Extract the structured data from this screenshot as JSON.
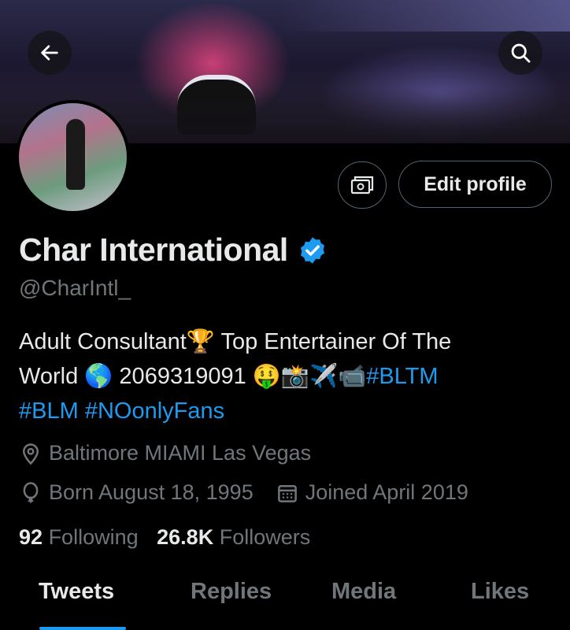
{
  "header": {
    "back_icon": "arrow-left-icon",
    "search_icon": "search-icon"
  },
  "actions": {
    "tip_icon": "money-icon",
    "edit_profile_label": "Edit profile"
  },
  "profile": {
    "name": "Char International",
    "verified": true,
    "handle": "@CharIntl_",
    "bio": {
      "line1_text": "Adult Consultant",
      "line1_emoji": "🏆",
      "line1_rest": " Top Entertainer Of The",
      "line2_text": "World ",
      "line2_emoji": "🌎",
      "line2_number": " 2069319091 ",
      "line2_emojis": "🤑📸✈️📹 ",
      "hashtag1": "#BLTM",
      "hashtag2": "#BLM",
      "hashtag3": "#NOonlyFans"
    },
    "location": "Baltimore MIAMI Las Vegas",
    "born": "Born August 18, 1995",
    "joined": "Joined April 2019"
  },
  "stats": {
    "following_count": "92",
    "following_label": "Following",
    "followers_count": "26.8K",
    "followers_label": "Followers"
  },
  "tabs": [
    {
      "label": "Tweets",
      "active": true
    },
    {
      "label": "Replies",
      "active": false
    },
    {
      "label": "Media",
      "active": false
    },
    {
      "label": "Likes",
      "active": false
    }
  ],
  "colors": {
    "accent": "#1d9bf0",
    "text_primary": "#e7e9ea",
    "text_secondary": "#71767b",
    "background": "#000000"
  }
}
